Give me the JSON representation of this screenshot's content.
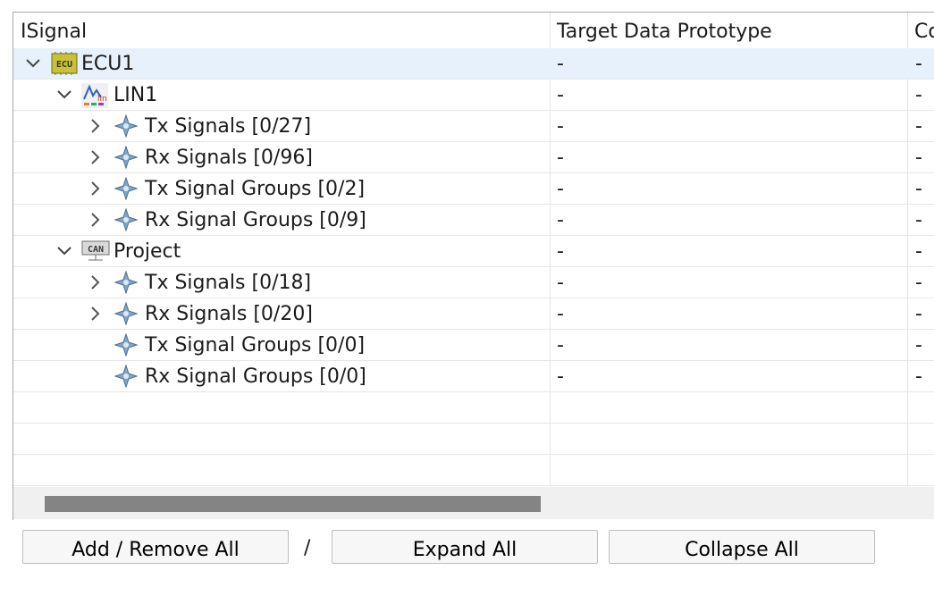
{
  "columns": {
    "signal": "ISignal",
    "target": "Target Data Prototype",
    "third": "Co"
  },
  "tree": {
    "ecu1": {
      "label": "ECU1",
      "icon_text": "ECU",
      "target": "-",
      "third": "-"
    },
    "lin1": {
      "label": "LIN1",
      "target": "-",
      "third": "-"
    },
    "lin_tx_signals": {
      "label": "Tx Signals [0/27]",
      "target": "-",
      "third": "-"
    },
    "lin_rx_signals": {
      "label": "Rx Signals [0/96]",
      "target": "-",
      "third": "-"
    },
    "lin_tx_groups": {
      "label": "Tx Signal Groups [0/2]",
      "target": "-",
      "third": "-"
    },
    "lin_rx_groups": {
      "label": "Rx Signal Groups [0/9]",
      "target": "-",
      "third": "-"
    },
    "project": {
      "label": "Project",
      "icon_text": "CAN",
      "target": "-",
      "third": "-"
    },
    "proj_tx_signals": {
      "label": "Tx Signals [0/18]",
      "target": "-",
      "third": "-"
    },
    "proj_rx_signals": {
      "label": "Rx Signals [0/20]",
      "target": "-",
      "third": "-"
    },
    "proj_tx_groups": {
      "label": "Tx Signal Groups [0/0]",
      "target": "-",
      "third": "-"
    },
    "proj_rx_groups": {
      "label": "Rx Signal Groups [0/0]",
      "target": "-",
      "third": "-"
    }
  },
  "buttons": {
    "add_remove": "Add / Remove All",
    "separator": "/",
    "expand": "Expand All",
    "collapse": "Collapse All"
  },
  "icons": {
    "ecu": "ecu-chip-icon",
    "lin": "lin-bus-icon",
    "can": "can-bus-icon",
    "signal": "signal-diamond-icon",
    "expanded": "chevron-down-icon",
    "collapsed": "chevron-right-icon"
  }
}
